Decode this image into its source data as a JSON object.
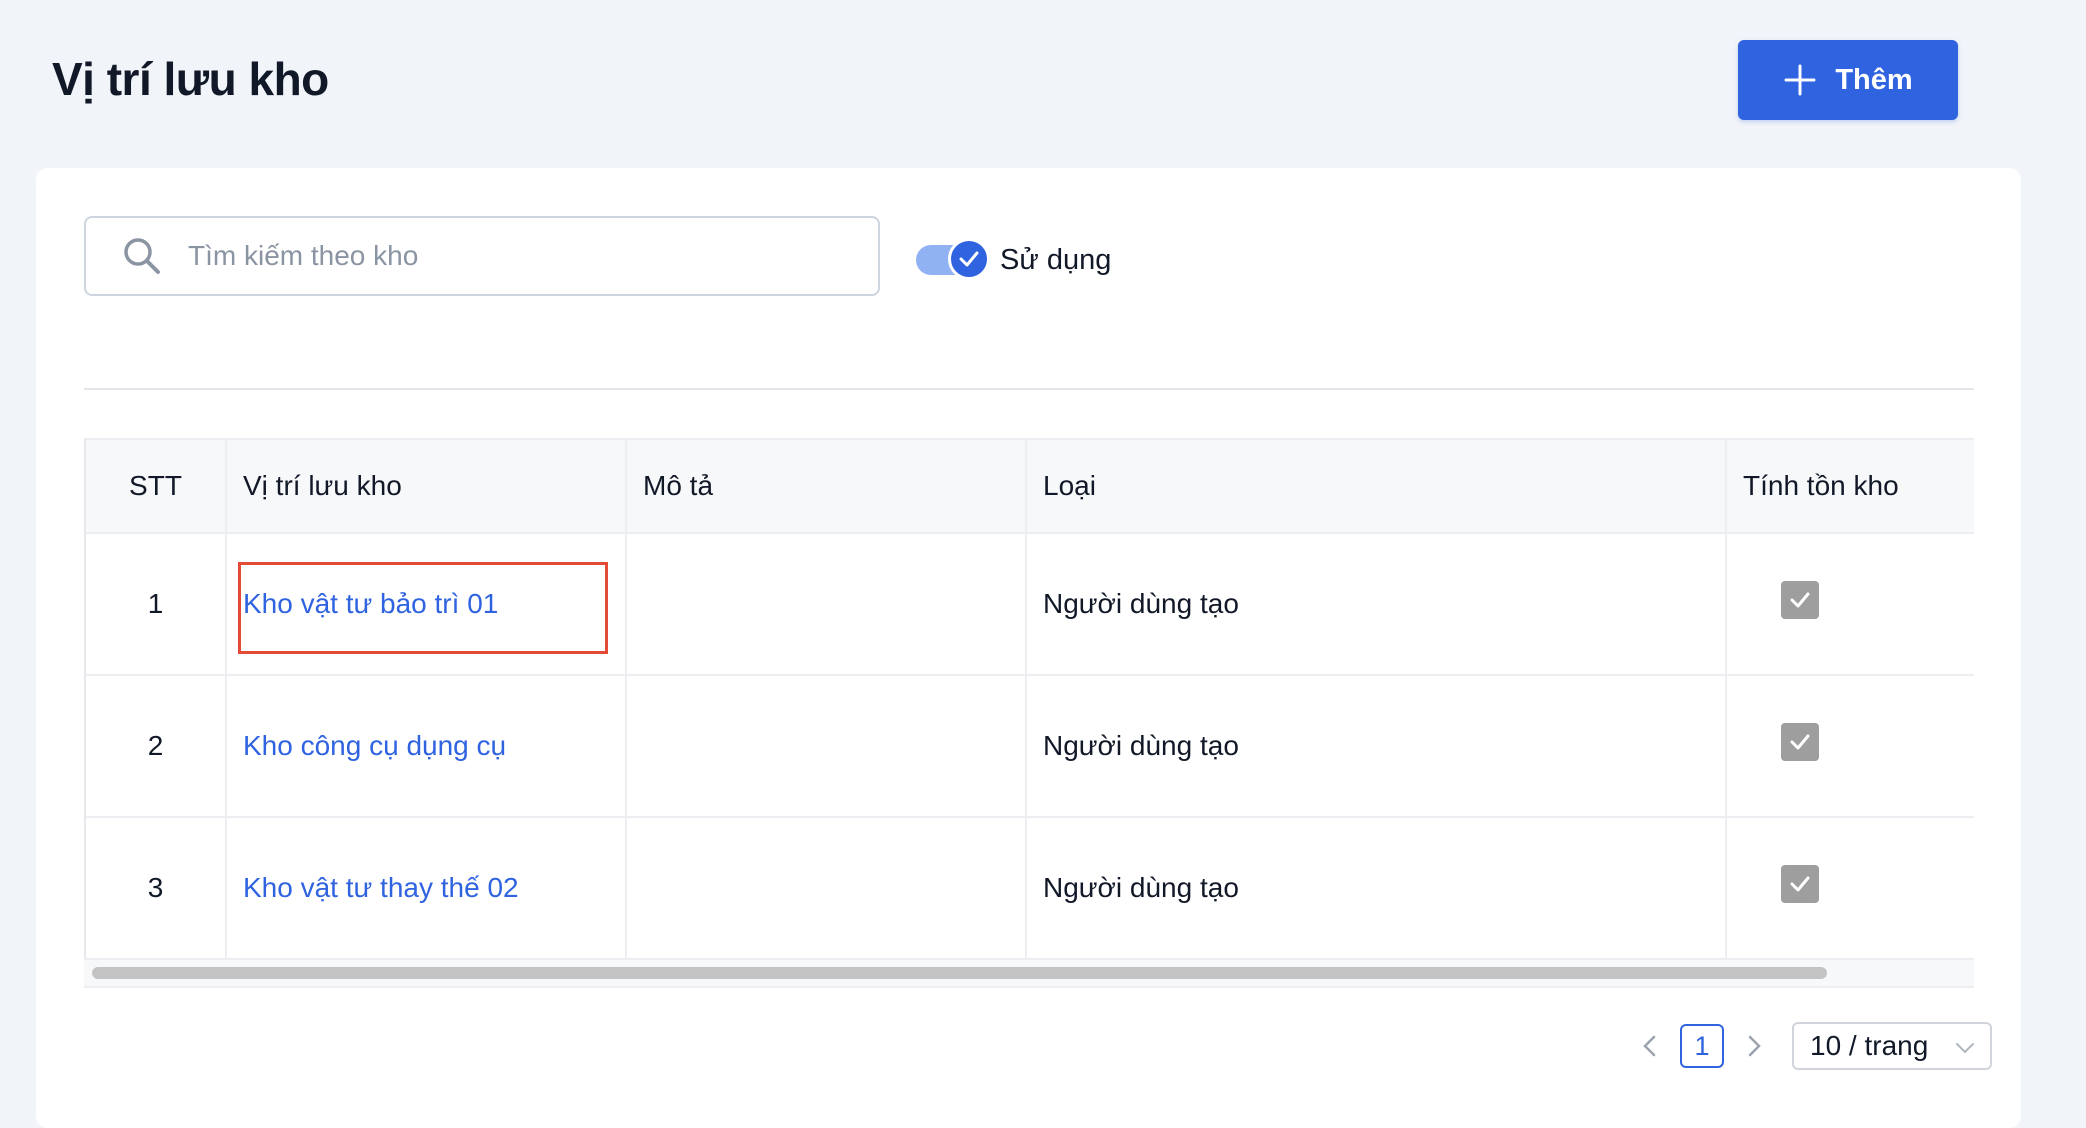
{
  "header": {
    "title": "Vị trí lưu kho",
    "add_label": "Thêm"
  },
  "filters": {
    "search_placeholder": "Tìm kiếm theo kho",
    "search_value": "",
    "toggle_label": "Sử dụng",
    "toggle_on": true
  },
  "table": {
    "columns": [
      "STT",
      "Vị trí lưu kho",
      "Mô tả",
      "Loại",
      "Tính tồn kho"
    ],
    "rows": [
      {
        "stt": "1",
        "name": "Kho vật tư bảo trì 01",
        "description": "",
        "type": "Người dùng tạo",
        "inventory": true
      },
      {
        "stt": "2",
        "name": "Kho công cụ dụng cụ",
        "description": "",
        "type": "Người dùng tạo",
        "inventory": true
      },
      {
        "stt": "3",
        "name": "Kho vật tư thay thế 02",
        "description": "",
        "type": "Người dùng tạo",
        "inventory": true
      }
    ]
  },
  "pagination": {
    "current_page": "1",
    "page_size": "10 / trang"
  },
  "colors": {
    "accent": "#2f63e0",
    "highlight": "#e34b36",
    "checkbox": "#9e9e9e"
  }
}
